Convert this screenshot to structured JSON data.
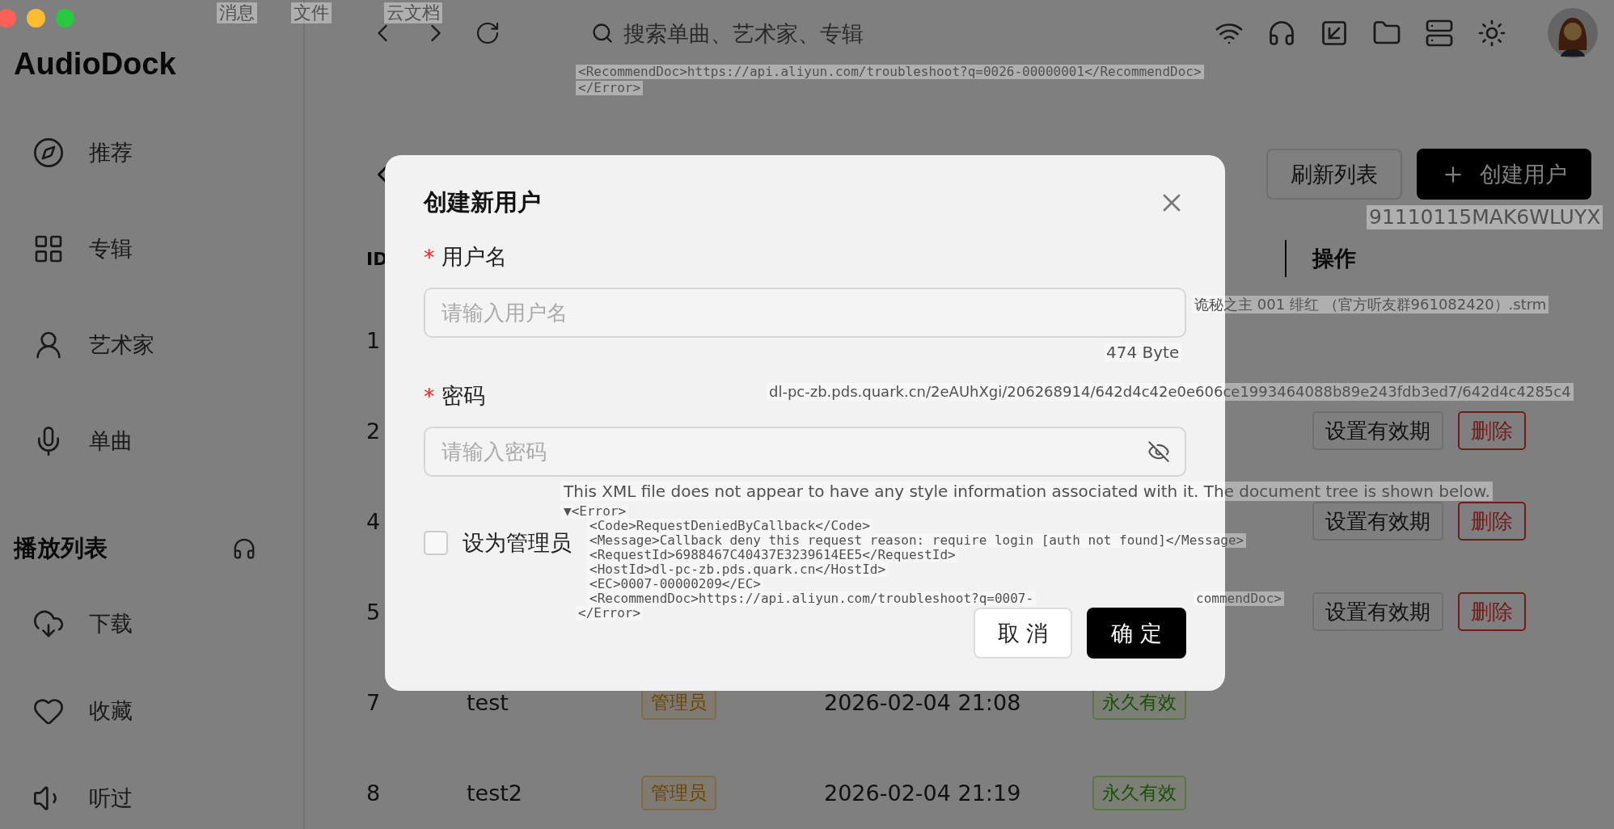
{
  "app_title": "AudioDock",
  "sidebar": {
    "items": [
      {
        "label": "推荐"
      },
      {
        "label": "专辑"
      },
      {
        "label": "艺术家"
      },
      {
        "label": "单曲"
      }
    ],
    "playlist_heading": "播放列表",
    "playlist_items": [
      {
        "label": "下载"
      },
      {
        "label": "收藏"
      },
      {
        "label": "听过"
      }
    ]
  },
  "toolbar": {
    "search": {
      "placeholder": "搜索单曲、艺术家、专辑"
    }
  },
  "page": {
    "buttons": [
      {
        "label": "刷新列表",
        "kind": "default"
      },
      {
        "label": "创建用户",
        "kind": "primary"
      }
    ],
    "table": {
      "columns": [
        "ID",
        "操作"
      ],
      "rows": [
        {
          "id": "1"
        },
        {
          "id": "2",
          "actions": [
            "设置有效期",
            "删除"
          ]
        },
        {
          "id": "4",
          "actions": [
            "设置有效期",
            "删除"
          ]
        },
        {
          "id": "5",
          "actions": [
            "设置有效期",
            "删除"
          ]
        },
        {
          "id": "7",
          "username": "test",
          "role": "管理员",
          "created": "2026-02-04 21:08",
          "validity": "永久有效"
        },
        {
          "id": "8",
          "username": "test2",
          "role": "管理员",
          "created": "2026-02-04 21:19",
          "validity": "永久有效"
        }
      ]
    }
  },
  "dialog": {
    "title": "创建新用户",
    "fields": [
      {
        "label": "用户名",
        "required_mark": "*",
        "placeholder": "请输入用户名",
        "kind": "text"
      },
      {
        "label": "密码",
        "required_mark": "*",
        "placeholder": "请输入密码",
        "kind": "password"
      }
    ],
    "checkbox": {
      "label": "设为管理员",
      "checked": false
    },
    "buttons": [
      {
        "label": "取 消",
        "kind": "default"
      },
      {
        "label": "确 定",
        "kind": "primary"
      }
    ]
  },
  "background_windows": [
    {
      "kind": "tab",
      "text": "消息"
    },
    {
      "kind": "tab",
      "text": "文件"
    },
    {
      "kind": "tab",
      "text": "云文档"
    },
    {
      "kind": "code",
      "text": "<RecommendDoc>https://api.aliyun.com/troubleshoot?q=0026-00000001</RecommendDoc>"
    },
    {
      "kind": "code",
      "text": "</Error>"
    },
    {
      "kind": "label",
      "text": "91110115MAK6WLUYX"
    },
    {
      "kind": "file",
      "text": "诡秘之主 001 绯红 （官方听友群961082420）.strm"
    },
    {
      "kind": "size",
      "text": "474 Byte"
    },
    {
      "kind": "url",
      "text": "dl-pc-zb.pds.quark.cn/2eAUhXgi/206268914/642d4c42e0e606ce1993464088b89e243fdb3ed7/642d4c4285c4"
    },
    {
      "kind": "notice",
      "text": "This XML file does not appear to have any style information associated with it. The document tree is shown below."
    },
    {
      "kind": "code",
      "text": "▼<Error>"
    },
    {
      "kind": "code",
      "text": "<Code>RequestDeniedByCallback</Code>"
    },
    {
      "kind": "code",
      "text": "<Message>Callback deny this request reason: require login [auth not found]</Message>"
    },
    {
      "kind": "code",
      "text": "<RequestId>6988467C40437E3239614EE5</RequestId>"
    },
    {
      "kind": "code",
      "text": "<HostId>dl-pc-zb.pds.quark.cn</HostId>"
    },
    {
      "kind": "code",
      "text": "<EC>0007-00000209</EC>"
    },
    {
      "kind": "code",
      "text": "<RecommendDoc>https://api.aliyun.com/troubleshoot?q=0007-"
    },
    {
      "kind": "code",
      "text": "commendDoc>"
    },
    {
      "kind": "code",
      "text": "</Error>"
    }
  ]
}
